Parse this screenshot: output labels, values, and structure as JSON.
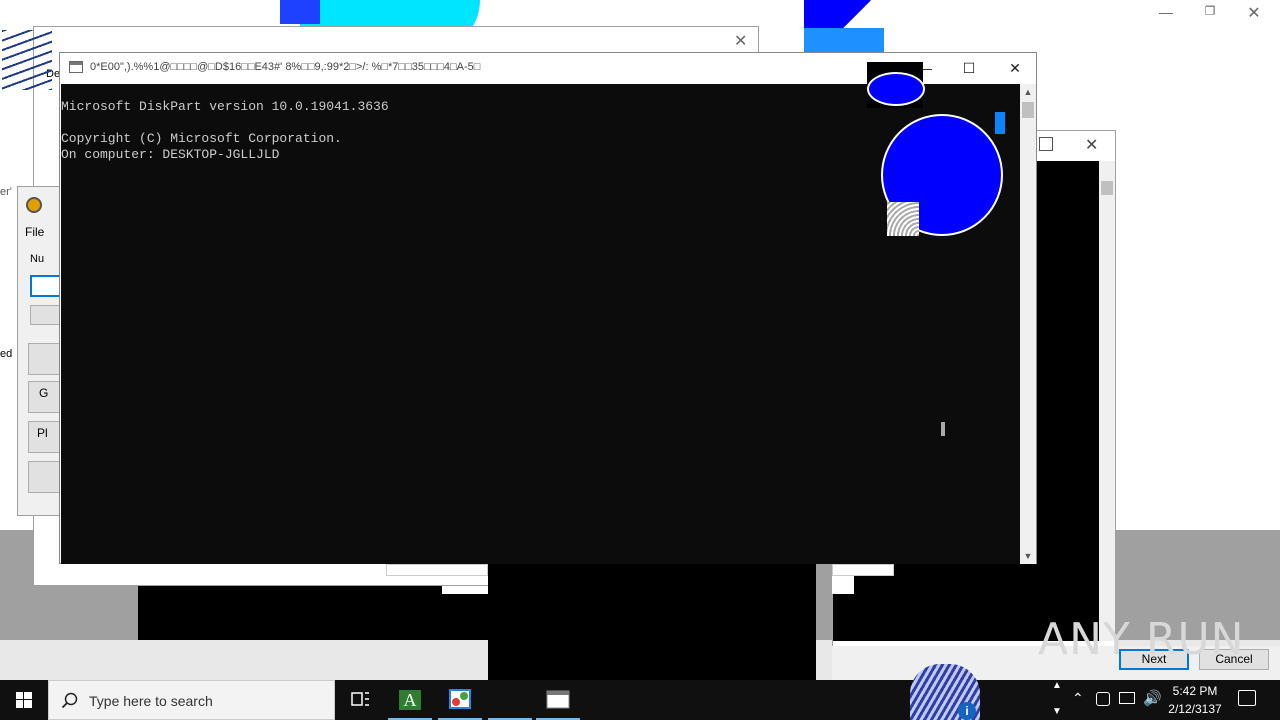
{
  "console": {
    "title": "0*E00\",).%%1@□□□□@□D$16□□E43#' 8%□□9,:99*2□>/: %□*7□□35□□□4□A-5□",
    "lines": [
      "Microsoft DiskPart version 10.0.19041.3636",
      "",
      "Copyright (C) Microsoft Corporation.",
      "On computer: DESKTOP-JGLLJLD"
    ]
  },
  "left_window": {
    "menu_file": "File",
    "label_num": "Nu",
    "btn_g": "G",
    "btn_pl": "Pl",
    "edge_label": "De",
    "edge_text_1": "er'",
    "edge_text_2": "ed"
  },
  "wizard": {
    "next_label": "Next",
    "cancel_label": "Cancel"
  },
  "watermark": "ANY RUN",
  "taskbar": {
    "search_placeholder": "Type here to search",
    "time": "5:42 PM",
    "date": "2/12/3137"
  },
  "colors": {
    "console_bg": "#0c0c0c",
    "console_fg": "#cccccc",
    "taskbar_bg": "#101010",
    "accent": "#0078d7",
    "artifact_blue": "#0000ff",
    "artifact_cyan": "#00ffff"
  }
}
